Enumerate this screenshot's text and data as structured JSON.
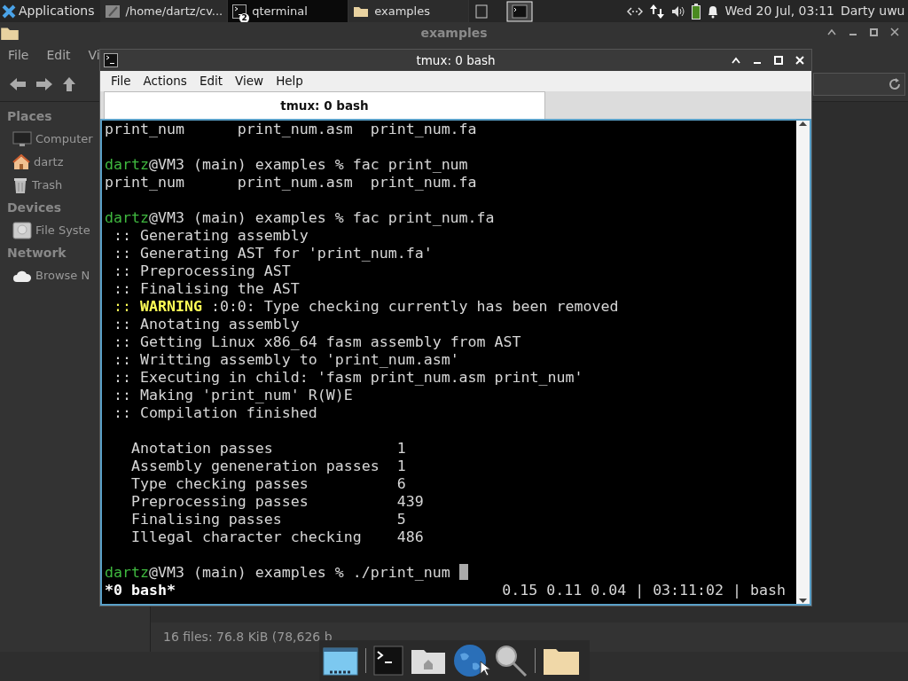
{
  "top_panel": {
    "apps_menu": "Applications",
    "tasks": [
      {
        "label": "/home/dartz/cv...",
        "selected": false
      },
      {
        "label": "qterminal",
        "badge": "2",
        "selected": true
      },
      {
        "label": "examples",
        "selected": false
      }
    ],
    "clock": "Wed 20 Jul, 03:11",
    "user": "Darty uwu"
  },
  "file_manager": {
    "title": "examples",
    "menu": [
      "File",
      "Edit",
      "Vi"
    ],
    "sidebar": [
      {
        "heading": "Places",
        "items": [
          {
            "label": "Computer"
          },
          {
            "label": "dartz"
          },
          {
            "label": "Trash"
          }
        ]
      },
      {
        "heading": "Devices",
        "items": [
          {
            "label": "File Syste"
          }
        ]
      },
      {
        "heading": "Network",
        "items": [
          {
            "label": "Browse N"
          }
        ]
      }
    ],
    "status": "16 files: 76.8 KiB (78,626 b"
  },
  "terminal": {
    "title": "tmux: 0 bash",
    "menu": [
      "File",
      "Actions",
      "Edit",
      "View",
      "Help"
    ],
    "tabs": [
      {
        "label": "tmux: 0 bash",
        "selected": true
      }
    ],
    "lines": [
      {
        "kind": "output",
        "text": "print_num      print_num.asm  print_num.fa"
      },
      {
        "kind": "blank"
      },
      {
        "kind": "prompt",
        "user": "dartz",
        "text": "@VM3 (main) examples % fac print_num"
      },
      {
        "kind": "output",
        "text": "print_num      print_num.asm  print_num.fa"
      },
      {
        "kind": "blank"
      },
      {
        "kind": "prompt",
        "user": "dartz",
        "text": "@VM3 (main) examples % fac print_num.fa"
      },
      {
        "kind": "step",
        "marker": "::",
        "text": "Generating assembly"
      },
      {
        "kind": "step",
        "marker": "::",
        "text": "Generating AST for 'print_num.fa'"
      },
      {
        "kind": "step",
        "marker": "::",
        "text": "Preprocessing AST"
      },
      {
        "kind": "step",
        "marker": "::",
        "text": "Finalising the AST"
      },
      {
        "kind": "warning",
        "marker": "::",
        "label": "WARNING",
        "text": " :0:0: Type checking currently has been removed"
      },
      {
        "kind": "step",
        "marker": "::",
        "text": "Anotating assembly"
      },
      {
        "kind": "step",
        "marker": "::",
        "text": "Getting Linux x86_64 fasm assembly from AST"
      },
      {
        "kind": "step",
        "marker": "::",
        "text": "Writting assembly to 'print_num.asm'"
      },
      {
        "kind": "step",
        "marker": "::",
        "text": "Executing in child: 'fasm print_num.asm print_num'"
      },
      {
        "kind": "step",
        "marker": "::",
        "text": "Making 'print_num' R(W)E"
      },
      {
        "kind": "step",
        "marker": "::",
        "text": "Compilation finished"
      },
      {
        "kind": "blank"
      },
      {
        "kind": "stat",
        "label": "Anotation passes",
        "value": "1"
      },
      {
        "kind": "stat",
        "label": "Assembly geneneration passes",
        "value": "1"
      },
      {
        "kind": "stat",
        "label": "Type checking passes",
        "value": "6"
      },
      {
        "kind": "stat",
        "label": "Preprocessing passes",
        "value": "439"
      },
      {
        "kind": "stat",
        "label": "Finalising passes",
        "value": "5"
      },
      {
        "kind": "stat",
        "label": "Illegal character checking",
        "value": "486"
      },
      {
        "kind": "blank"
      },
      {
        "kind": "prompt",
        "user": "dartz",
        "text": "@VM3 (main) examples % ./print_num",
        "cursor": true
      }
    ],
    "status_left": "*0 bash*",
    "status_right": "0.15 0.11 0.04 | 03:11:02 | bash"
  }
}
